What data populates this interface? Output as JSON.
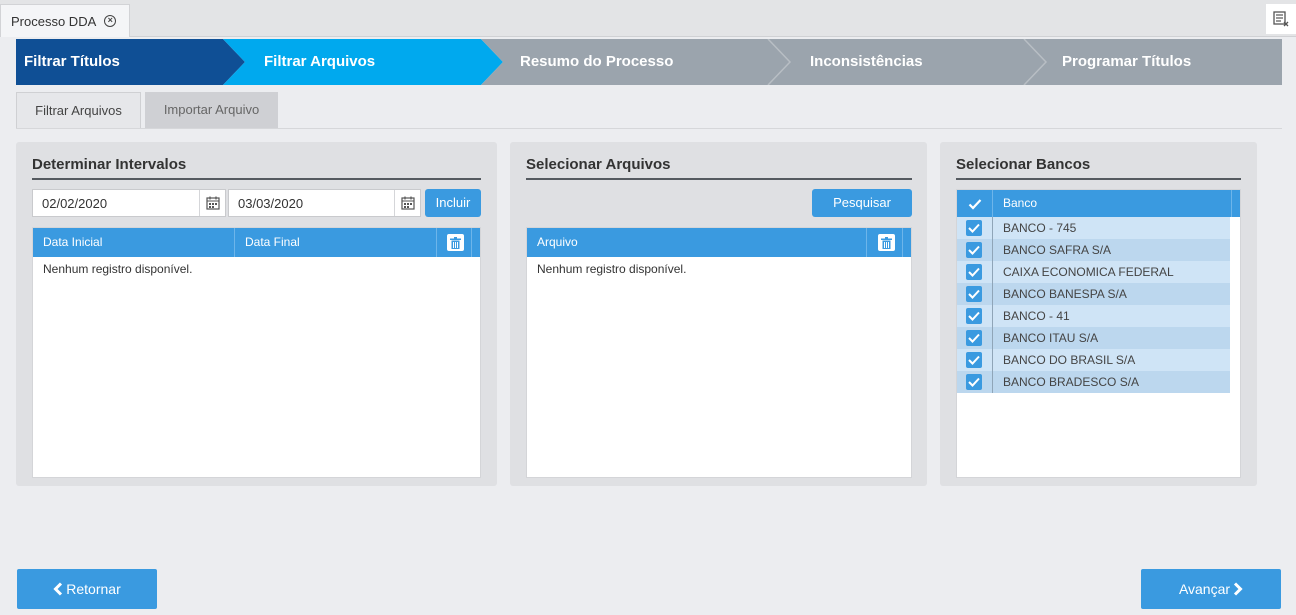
{
  "tab": {
    "title": "Processo DDA"
  },
  "wizard": {
    "steps": [
      {
        "label": "Filtrar Títulos",
        "state": "completed"
      },
      {
        "label": "Filtrar Arquivos",
        "state": "current"
      },
      {
        "label": "Resumo do Processo",
        "state": "pending"
      },
      {
        "label": "Inconsistências",
        "state": "pending"
      },
      {
        "label": "Programar Títulos",
        "state": "pending"
      }
    ],
    "colors": {
      "completed": "#0f4f95",
      "current": "#00a9ee",
      "pending": "#9ba4ad"
    }
  },
  "subtabs": [
    {
      "label": "Filtrar Arquivos",
      "active": true
    },
    {
      "label": "Importar Arquivo",
      "active": false
    }
  ],
  "intervals": {
    "title": "Determinar Intervalos",
    "start_date": "02/02/2020",
    "end_date": "03/03/2020",
    "include_label": "Incluir",
    "columns": [
      "Data Inicial",
      "Data Final"
    ],
    "empty_text": "Nenhum registro disponível."
  },
  "files": {
    "title": "Selecionar Arquivos",
    "search_label": "Pesquisar",
    "columns": [
      "Arquivo"
    ],
    "empty_text": "Nenhum registro disponível."
  },
  "banks": {
    "title": "Selecionar Bancos",
    "column": "Banco",
    "rows": [
      {
        "name": "BANCO - 745",
        "checked": true
      },
      {
        "name": "BANCO SAFRA S/A",
        "checked": true
      },
      {
        "name": "CAIXA ECONOMICA FEDERAL",
        "checked": true
      },
      {
        "name": "BANCO BANESPA S/A",
        "checked": true
      },
      {
        "name": "BANCO - 41",
        "checked": true
      },
      {
        "name": "BANCO ITAU S/A",
        "checked": true
      },
      {
        "name": "BANCO DO BRASIL S/A",
        "checked": true
      },
      {
        "name": "BANCO BRADESCO S/A",
        "checked": true
      }
    ]
  },
  "nav": {
    "back_label": "Retornar",
    "next_label": "Avançar"
  }
}
